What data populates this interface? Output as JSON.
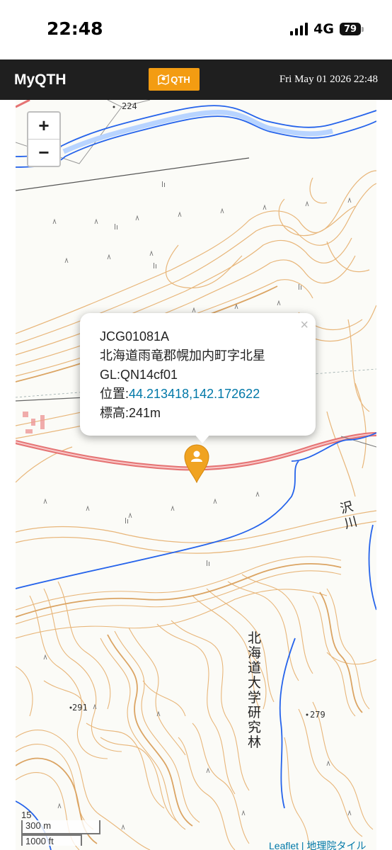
{
  "status": {
    "time": "22:48",
    "network": "4G",
    "battery": "79"
  },
  "header": {
    "title": "MyQTH",
    "qth_button_label": "QTH",
    "datetime": "Fri May 01 2026 22:48"
  },
  "map": {
    "zoom_in": "+",
    "zoom_out": "−",
    "spot_labels": [
      "224",
      "291",
      "279"
    ],
    "place_text_1": "北海道大学研究林",
    "river_text": "沢川",
    "scale_level": "15",
    "scale_metric": "300 m",
    "scale_imperial": "1000 ft",
    "attribution": "Leaflet | 地理院タイル"
  },
  "popup": {
    "close": "×",
    "code": "JCG01081A",
    "address": "北海道雨竜郡幌加内町字北星",
    "grid": "GL:QN14cf01",
    "position_label": "位置:",
    "position_link": "44.213418,142.172622",
    "elevation": "標高:241m"
  },
  "colors": {
    "accent": "#f39c12",
    "header_bg": "#1f1f1f",
    "link": "#0078a8",
    "contour": "#e8b67a",
    "river": "#2563eb",
    "road": "#e57373"
  }
}
